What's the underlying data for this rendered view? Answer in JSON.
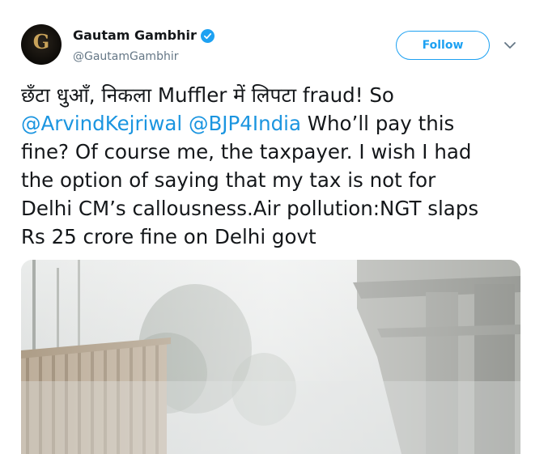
{
  "tweet": {
    "author": {
      "display_name": "Gautam Gambhir",
      "handle": "@GautamGambhir",
      "verified": true,
      "avatar_mark": "G"
    },
    "follow_label": "Follow",
    "text_lines": [
      "छँटा धुआँ, निकला Muffler में लिपटा fraud! So",
      [
        "@ArvindKejriwal",
        " ",
        "@BJP4India",
        " Who’ll pay this"
      ],
      "fine? Of course me, the taxpayer. I wish I had",
      "the option of saying that my tax is not for",
      "Delhi CM’s callousness.Air pollution:NGT slaps",
      "Rs 25 crore fine on Delhi govt"
    ],
    "media_description_icon": "smog-flyover-photo"
  },
  "colors": {
    "accent": "#1da1f2",
    "mention": "#1b95e0",
    "text": "#14171a",
    "secondary": "#657786"
  }
}
